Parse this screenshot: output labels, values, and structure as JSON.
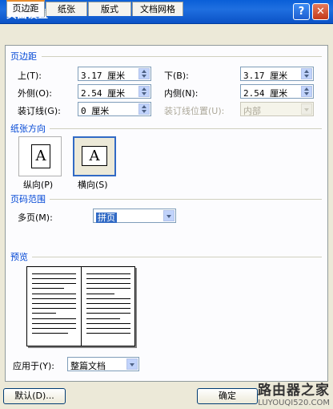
{
  "window": {
    "title": "页面设置",
    "help": "?",
    "close": "✕"
  },
  "tabs": [
    "页边距",
    "纸张",
    "版式",
    "文档网格"
  ],
  "margins": {
    "section": "页边距",
    "top_label": "上(T):",
    "top_value": "3.17 厘米",
    "bottom_label": "下(B):",
    "bottom_value": "3.17 厘米",
    "outer_label": "外侧(O):",
    "outer_value": "2.54 厘米",
    "inner_label": "内侧(N):",
    "inner_value": "2.54 厘米",
    "gutter_label": "装订线(G):",
    "gutter_value": "0 厘米",
    "gutter_pos_label": "装订线位置(U):",
    "gutter_pos_value": "内部"
  },
  "orientation": {
    "section": "纸张方向",
    "portrait": "纵向(P)",
    "landscape": "横向(S)",
    "glyph": "A"
  },
  "pages": {
    "section": "页码范围",
    "multi_label": "多页(M):",
    "multi_value": "拼页"
  },
  "preview": {
    "section": "预览"
  },
  "apply": {
    "label": "应用于(Y):",
    "value": "整篇文档"
  },
  "buttons": {
    "default": "默认(D)...",
    "ok": "确定"
  },
  "watermark": {
    "line1": "路由器之家",
    "line2": "LUYOUQI520.COM"
  }
}
